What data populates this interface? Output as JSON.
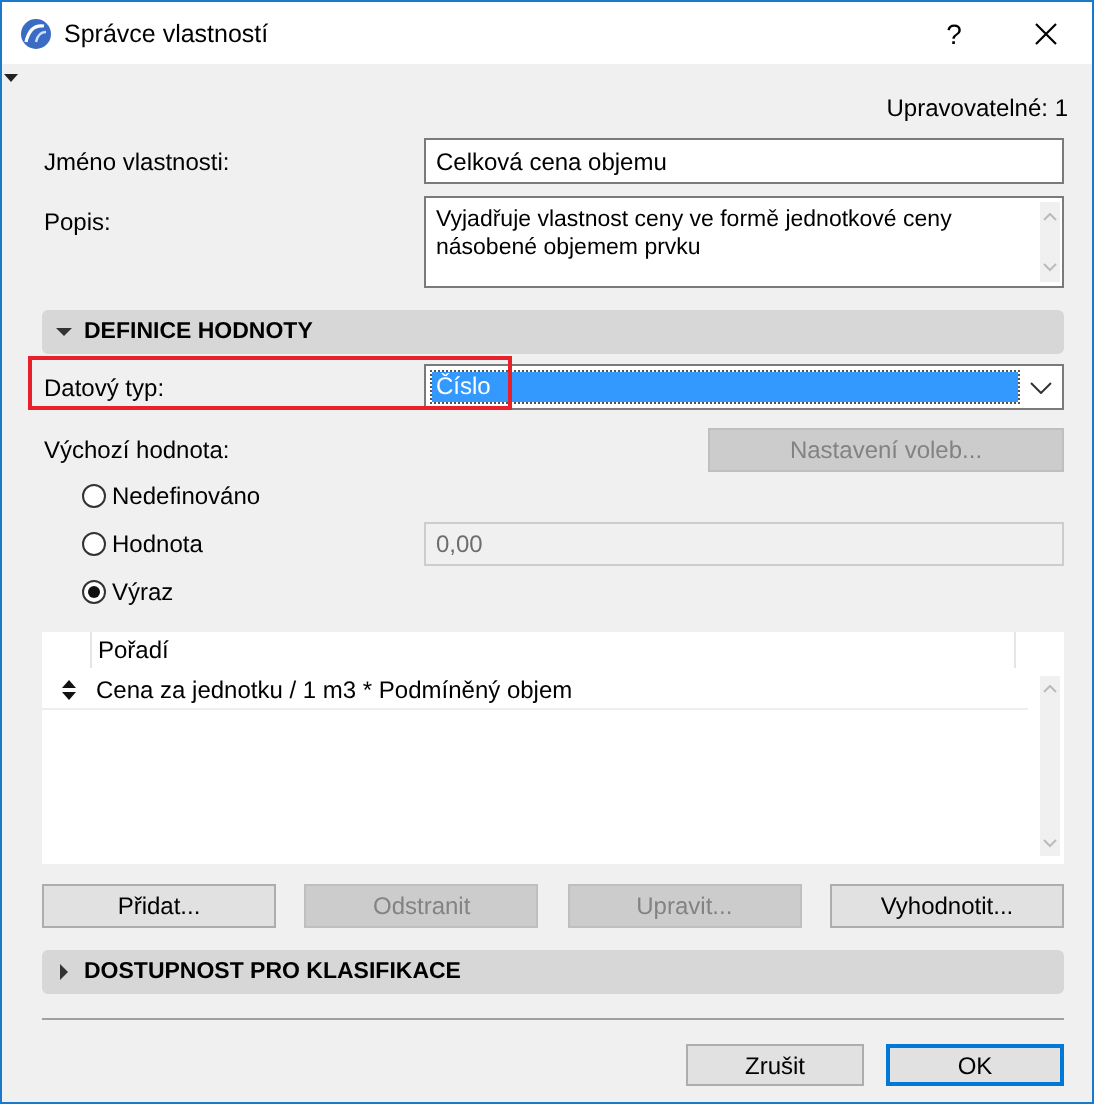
{
  "window": {
    "title": "Správce vlastností",
    "help": "?"
  },
  "editable": "Upravovatelné: 1",
  "fields": [
    {
      "kind": "text",
      "label": "Jméno vlastnosti:",
      "value": "Celková cena objemu"
    },
    {
      "kind": "multiline",
      "label": "Popis:",
      "value": "Vyjadřuje vlastnost ceny ve formě jednotkové ceny násobené objemem prvku"
    }
  ],
  "value_section": {
    "title": "DEFINICE HODNOTY",
    "expanded": true,
    "data_type": {
      "label": "Datový typ:",
      "value": "Číslo",
      "highlighted": true
    },
    "default": {
      "label": "Výchozí hodnota:",
      "options_button": {
        "label": "Nastavení voleb...",
        "disabled": true
      }
    },
    "radios": [
      {
        "label": "Nedefinováno",
        "selected": false
      },
      {
        "label": "Hodnota",
        "selected": false,
        "field": "0,00"
      },
      {
        "label": "Výraz",
        "selected": true
      }
    ],
    "table": {
      "columns": [
        "Pořadí"
      ],
      "rows": [
        "Cena za jednotku / 1 m3 * Podmíněný objem"
      ]
    },
    "buttons": [
      {
        "label": "Přidat...",
        "disabled": false
      },
      {
        "label": "Odstranit",
        "disabled": true
      },
      {
        "label": "Upravit...",
        "disabled": true
      },
      {
        "label": "Vyhodnotit...",
        "disabled": false
      }
    ]
  },
  "classification_section": {
    "title": "DOSTUPNOST PRO KLASIFIKACE",
    "expanded": false
  },
  "footer_buttons": [
    {
      "label": "Zrušit",
      "default": false
    },
    {
      "label": "OK",
      "default": true
    }
  ]
}
